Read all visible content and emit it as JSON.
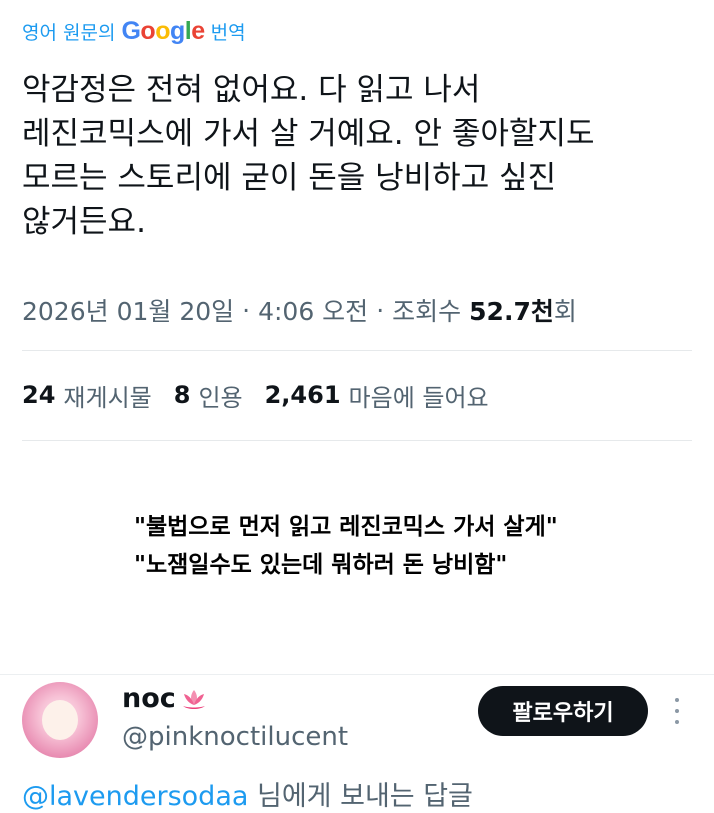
{
  "translation": {
    "prefix": "영어 원문의",
    "brand_letters": [
      {
        "ch": "G",
        "color": "#4285f4"
      },
      {
        "ch": "o",
        "color": "#ea4335"
      },
      {
        "ch": "o",
        "color": "#fbbc05"
      },
      {
        "ch": "g",
        "color": "#4285f4"
      },
      {
        "ch": "l",
        "color": "#34a853"
      },
      {
        "ch": "e",
        "color": "#ea4335"
      }
    ],
    "suffix": "번역"
  },
  "tweet": {
    "text": "악감정은 전혀 없어요. 다 읽고 나서\n레진코믹스에 가서 살 거예요. 안 좋아할지도\n모르는 스토리에 굳이 돈을 낭비하고 싶진\n않거든요.",
    "meta": {
      "date": "2026년 01월 20일",
      "separator": "·",
      "time": "4:06 오전",
      "views_label": "조회수",
      "views_number": "52.7천",
      "views_suffix": "회"
    },
    "stats": [
      {
        "number": "24",
        "label": "재게시물"
      },
      {
        "number": "8",
        "label": "인용"
      },
      {
        "number": "2,461",
        "label": "마음에 들어요"
      }
    ]
  },
  "caption": {
    "line1": "\"불법으로 먼저 읽고 레진코믹스 가서 살게\"",
    "line2": "\"노잼일수도 있는데 뭐하러 돈 낭비함\""
  },
  "reply": {
    "name": "noc",
    "handle": "@pinknoctilucent",
    "follow_label": "팔로우하기",
    "mention": "@lavendersodaa",
    "reply_suffix": " 님에게 보내는 답글"
  },
  "colors": {
    "accent": "#1d9bf0",
    "text_primary": "#0f1419",
    "text_secondary": "#536471",
    "follow_bg": "#0f1419"
  },
  "icons": {
    "brand_logo": "google-logo",
    "name_badge": "lotus-icon",
    "overflow": "more-vertical-icon"
  }
}
